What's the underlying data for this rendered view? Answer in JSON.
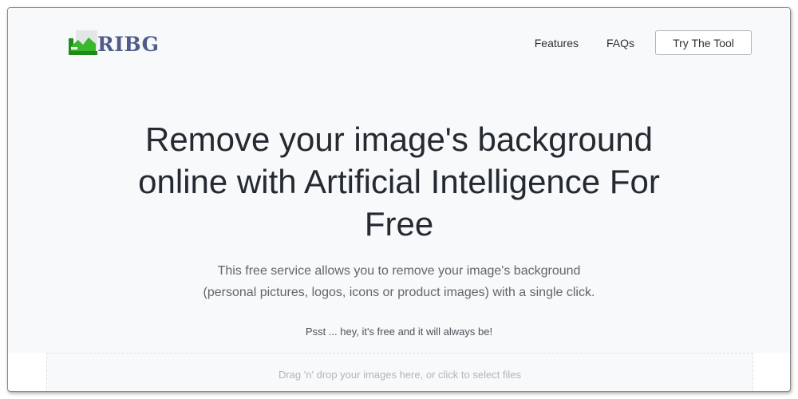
{
  "brand": {
    "logo_text": "RIBG",
    "logo_icon": "landscape-image-icon",
    "logo_color": "#515b88"
  },
  "nav": {
    "features_label": "Features",
    "faqs_label": "FAQs",
    "cta_label": "Try The Tool"
  },
  "hero": {
    "title_lines": [
      "Remove your image's background",
      "online with Artificial Intelligence For",
      "Free"
    ],
    "subtitle_lines": [
      "This free service allows you to remove your image's background",
      "(personal pictures, logos, icons or product images) with a single click."
    ],
    "note": "Psst ... hey, it's free and it will always be!"
  },
  "dropzone": {
    "text": "Drag 'n' drop your images here, or click to select files"
  },
  "colors": {
    "hero_background": "#f7f9fb",
    "title": "#242a30",
    "subtitle": "#5f666d",
    "logo_green": "#2e9f24"
  }
}
